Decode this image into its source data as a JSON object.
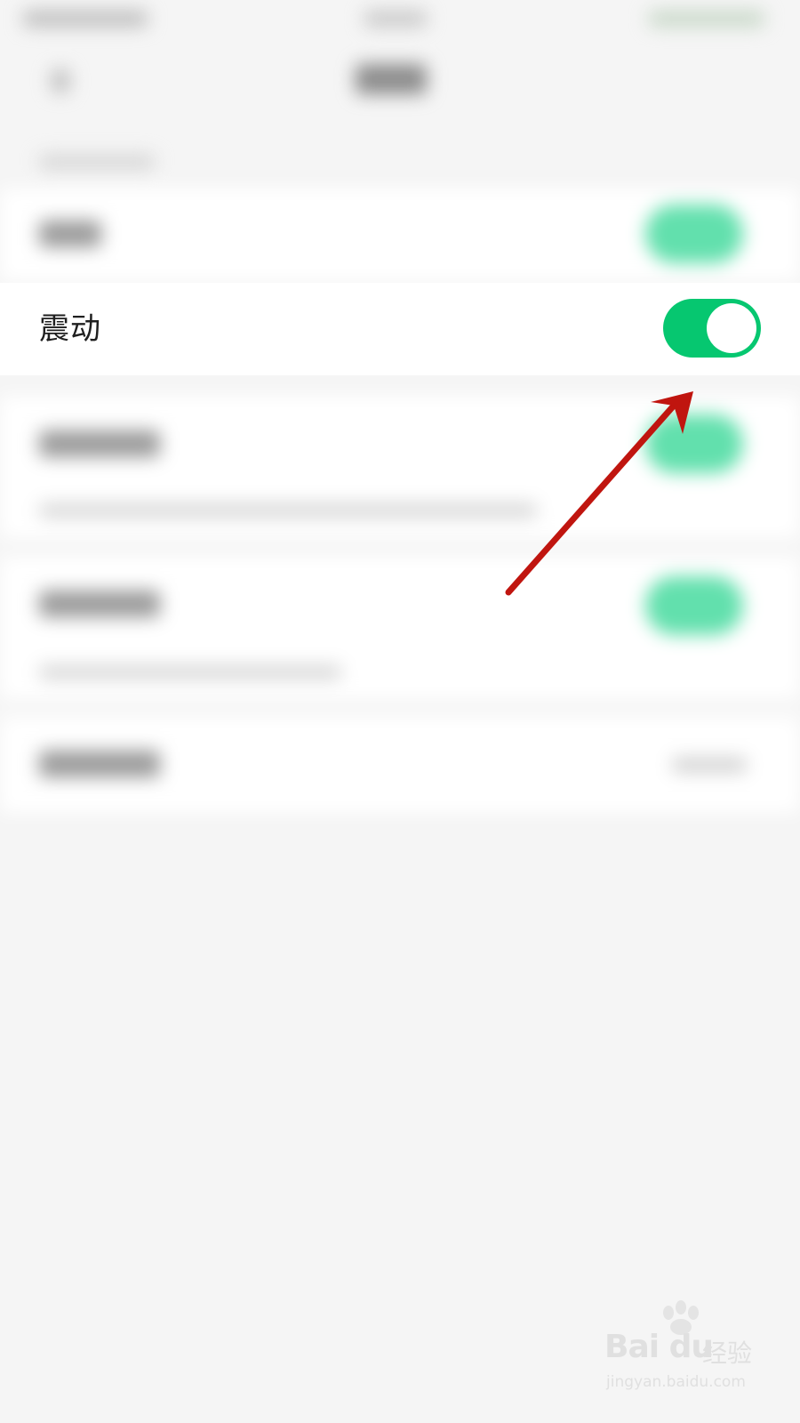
{
  "row": {
    "label": "震动",
    "toggle_on": true,
    "toggle_color": "#06c770"
  },
  "annotation": {
    "arrow_color": "#c0150f"
  },
  "watermark": {
    "brand": "Bai du",
    "sub": "经验",
    "url": "jingyan.baidu.com"
  }
}
